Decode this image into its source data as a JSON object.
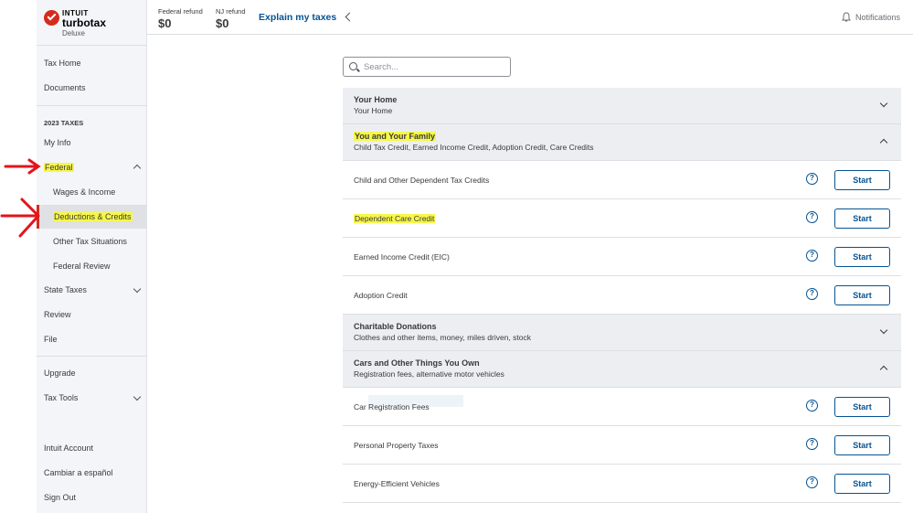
{
  "logo": {
    "brand_top": "INTUIT",
    "brand_main": "turbotax",
    "edition": "Deluxe"
  },
  "sidebar": {
    "top_items": [
      "Tax Home",
      "Documents"
    ],
    "section_header": "2023 TAXES",
    "my_info": "My Info",
    "federal": "Federal",
    "federal_sub": [
      "Wages & Income",
      "Deductions & Credits",
      "Other Tax Situations",
      "Federal Review"
    ],
    "state_taxes": "State Taxes",
    "review": "Review",
    "file": "File",
    "upgrade": "Upgrade",
    "tax_tools": "Tax Tools",
    "account_items": [
      "Intuit Account",
      "Cambiar a español",
      "Sign Out"
    ]
  },
  "topbar": {
    "federal_refund_label": "Federal refund",
    "federal_refund_value": "$0",
    "nj_refund_label": "NJ refund",
    "nj_refund_value": "$0",
    "explain_link": "Explain my taxes",
    "notifications": "Notifications"
  },
  "search": {
    "placeholder": "Search..."
  },
  "sections": [
    {
      "title": "Your Home",
      "subtitle": "Your Home",
      "expanded": false
    },
    {
      "title": "You and Your Family",
      "subtitle": "Child Tax Credit, Earned Income Credit, Adoption Credit, Care Credits",
      "expanded": true
    },
    {
      "title": "Charitable Donations",
      "subtitle": "Clothes and other items, money, miles driven, stock",
      "expanded": false
    },
    {
      "title": "Cars and Other Things You Own",
      "subtitle": "Registration fees, alternative motor vehicles",
      "expanded": true
    }
  ],
  "family_rows": [
    "Child and Other Dependent Tax Credits",
    "Dependent Care Credit",
    "Earned Income Credit (EIC)",
    "Adoption Credit"
  ],
  "cars_rows": [
    "Car Registration Fees",
    "Personal Property Taxes",
    "Energy-Efficient Vehicles"
  ],
  "start_label": "Start",
  "help_glyph": "?",
  "colors": {
    "accent": "#055393",
    "highlight": "#f7f74a",
    "brand_red": "#d52b1e",
    "annotation_arrow": "#e3141b"
  }
}
